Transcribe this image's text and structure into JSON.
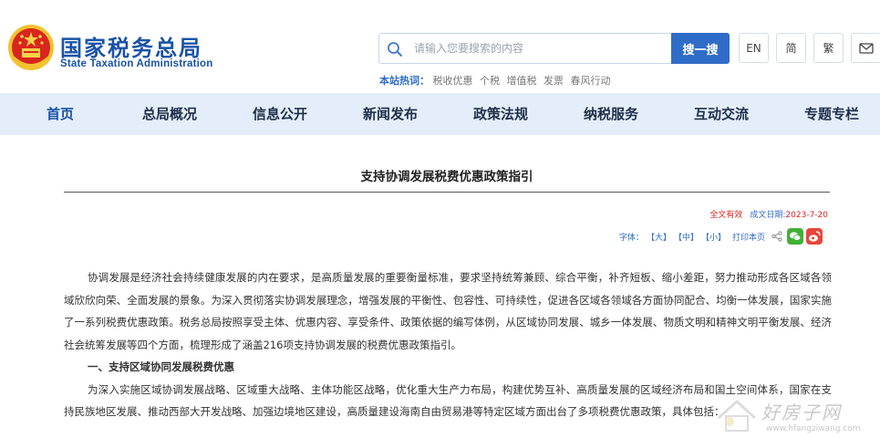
{
  "header": {
    "brand_cn": "国家税务总局",
    "brand_en": "State Taxation Administration",
    "search": {
      "placeholder": "请输入您要搜索的内容",
      "button_label": "搜一搜"
    },
    "hot": {
      "label": "本站热词：",
      "items": [
        "税收优惠",
        "个税",
        "增值税",
        "发票",
        "春风行动"
      ]
    },
    "utils": {
      "en_label": "EN",
      "simplified_label": "简",
      "traditional_label": "繁"
    }
  },
  "nav": {
    "items": [
      "首页",
      "总局概况",
      "信息公开",
      "新闻发布",
      "政策法规",
      "纳税服务",
      "互动交流",
      "专题专栏"
    ]
  },
  "article": {
    "title": "支持协调发展税费优惠政策指引",
    "status": "全文有效",
    "date_label": "成文日期:",
    "date": "2023-7-20",
    "font_label": "字体：",
    "font_large": "【大】",
    "font_medium": "【中】",
    "font_small": "【小】",
    "print_label": "打印本页",
    "paragraphs": [
      "协调发展是经济社会持续健康发展的内在要求，是高质量发展的重要衡量标准，要求坚持统筹兼顾、综合平衡，补齐短板、缩小差距，努力推动形成各区域各领域欣欣向荣、全面发展的景象。为深入贯彻落实协调发展理念，增强发展的平衡性、包容性、可持续性，促进各区域各领域各方面协同配合、均衡一体发展，国家实施了一系列税费优惠政策。税务总局按照享受主体、优惠内容、享受条件、政策依据的编写体例，从区域协同发展、城乡一体发展、物质文明和精神文明平衡发展、经济社会统筹发展等四个方面，梳理形成了涵盖216项支持协调发展的税费优惠政策指引。"
    ],
    "section_heading": "一、支持区域协同发展税费优惠",
    "paragraph2": "为深入实施区域协调发展战略、区域重大战略、主体功能区战略，优化重大生产力布局，构建优势互补、高质量发展的区域经济布局和国土空间体系，国家在支持民族地区发展、推动西部大开发战略、加强边境地区建设，高质量建设海南自由贸易港等特定区域方面出台了多项税费优惠政策，具体包括："
  },
  "watermark": {
    "text": "好房子网",
    "url": "www.hfangziwang.com"
  },
  "colors": {
    "brand_blue": "#1a53a6",
    "search_button": "#2f6cc8",
    "nav_background": "#e4eefa",
    "status_red": "#d22"
  },
  "icons": [
    "national-emblem-icon",
    "search-icon",
    "mail-icon",
    "share-icon",
    "wechat-icon",
    "weibo-icon"
  ]
}
